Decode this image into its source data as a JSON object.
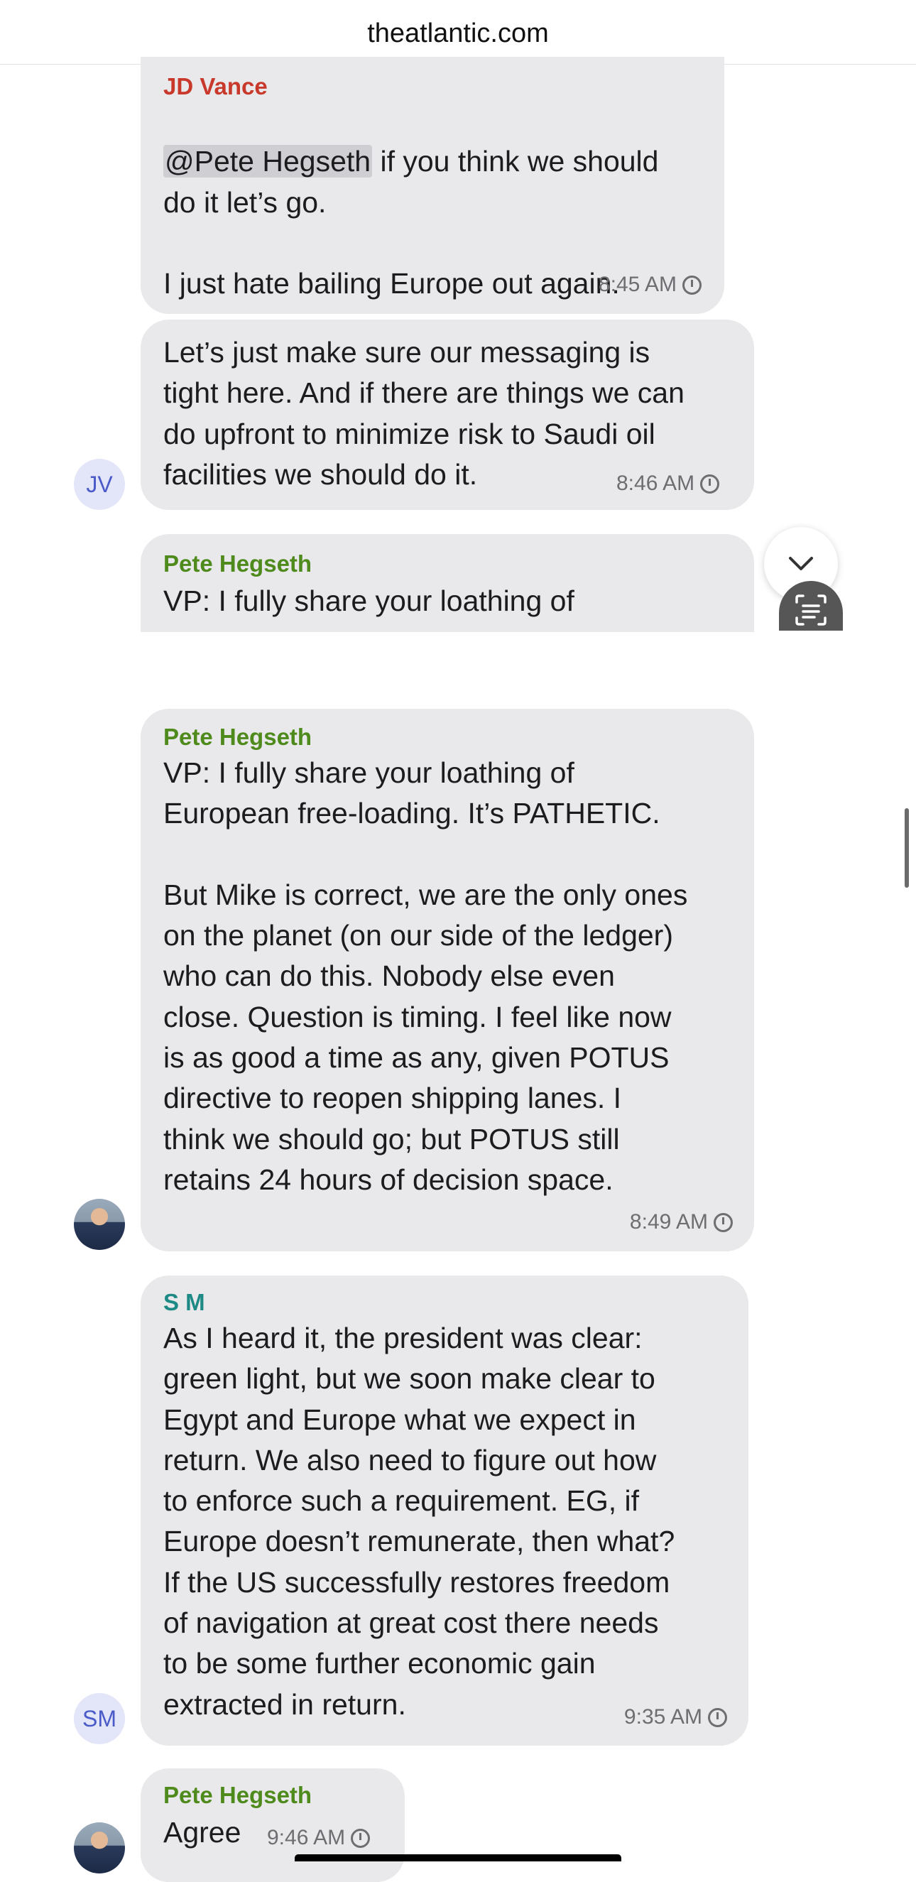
{
  "site": "theatlantic.com",
  "messages": [
    {
      "sender": "JD Vance",
      "mention": "@Pete Hegseth",
      "text_after_mention": " if you think we should\ndo it let’s go.\n\nI just hate bailing Europe out again.",
      "time": "8:45 AM"
    },
    {
      "text": "Let’s just make sure our messaging is\ntight here. And if there are things we can\ndo upfront to minimize risk to Saudi oil\nfacilities we should do it.",
      "time": "8:46 AM",
      "avatar": "JV"
    },
    {
      "sender": "Pete Hegseth",
      "text": "VP: I fully share your loathing of"
    },
    {
      "sender": "Pete Hegseth",
      "text": "VP: I fully share your loathing of\nEuropean free-loading. It’s PATHETIC.\n\nBut Mike is correct, we are the only ones\non the planet (on our side of the ledger)\nwho can do this. Nobody else even\nclose. Question is timing. I feel like now\nis as good a time as any, given POTUS\ndirective to reopen shipping lanes. I\nthink we should go; but POTUS still\nretains 24 hours of decision space.",
      "time": "8:49 AM"
    },
    {
      "sender": "S M",
      "text": "As I heard it, the president was clear:\ngreen light, but we soon make clear to\nEgypt and Europe what we expect in\nreturn. We also need to figure out how\nto enforce such a requirement. EG, if\nEurope doesn’t remunerate, then what?\nIf the US successfully restores freedom\nof navigation at great cost there needs\nto be some further economic gain\nextracted in return.",
      "time": "9:35 AM",
      "avatar": "SM"
    },
    {
      "sender": "Pete Hegseth",
      "text": "Agree",
      "time": "9:46 AM"
    }
  ],
  "colors": {
    "vance": "#c8392b",
    "hegseth": "#4f8a1c",
    "sm": "#1e8a86",
    "bubble": "#e9e9eb",
    "timestamp": "#6d6d72"
  },
  "icons": [
    "chevron-down-icon",
    "text-scan-icon",
    "clock-icon"
  ]
}
